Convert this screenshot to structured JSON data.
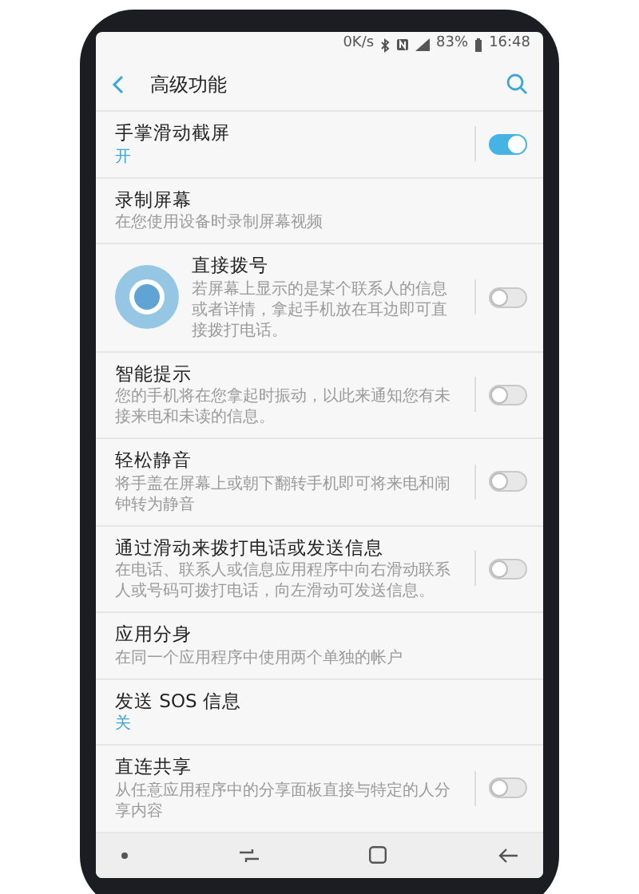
{
  "status_bar": {
    "speed": "0K/s",
    "battery": "83%",
    "time": "16:48"
  },
  "header": {
    "title": "高级功能"
  },
  "items": [
    {
      "title": "手掌滑动截屏",
      "value": "开",
      "kind": "toggle",
      "on": true,
      "touched": false
    },
    {
      "title": "录制屏幕",
      "description": "在您使用设备时录制屏幕视频",
      "kind": "plain",
      "touched": false
    },
    {
      "title": "直接拨号",
      "description": "若屏幕上显示的是某个联系人的信息或者详情，拿起手机放在耳边即可直接拨打电话。",
      "kind": "toggle",
      "on": false,
      "touched": true
    },
    {
      "title": "智能提示",
      "description": "您的手机将在您拿起时振动，以此来通知您有未接来电和未读的信息。",
      "kind": "toggle",
      "on": false,
      "touched": false
    },
    {
      "title": "轻松静音",
      "description": "将手盖在屏幕上或朝下翻转手机即可将来电和闹钟转为静音",
      "kind": "toggle",
      "on": false,
      "touched": false
    },
    {
      "title": "通过滑动来拨打电话或发送信息",
      "description": "在电话、联系人或信息应用程序中向右滑动联系人或号码可拨打电话，向左滑动可发送信息。",
      "kind": "toggle",
      "on": false,
      "touched": false
    },
    {
      "title": "应用分身",
      "description": "在同一个应用程序中使用两个单独的帐户",
      "kind": "plain",
      "touched": false
    },
    {
      "title": "发送 SOS 信息",
      "value": "关",
      "kind": "plain",
      "touched": false
    },
    {
      "title": "直连共享",
      "description": "从任意应用程序中的分享面板直接与特定的人分享内容",
      "kind": "toggle",
      "on": false,
      "touched": false
    }
  ]
}
